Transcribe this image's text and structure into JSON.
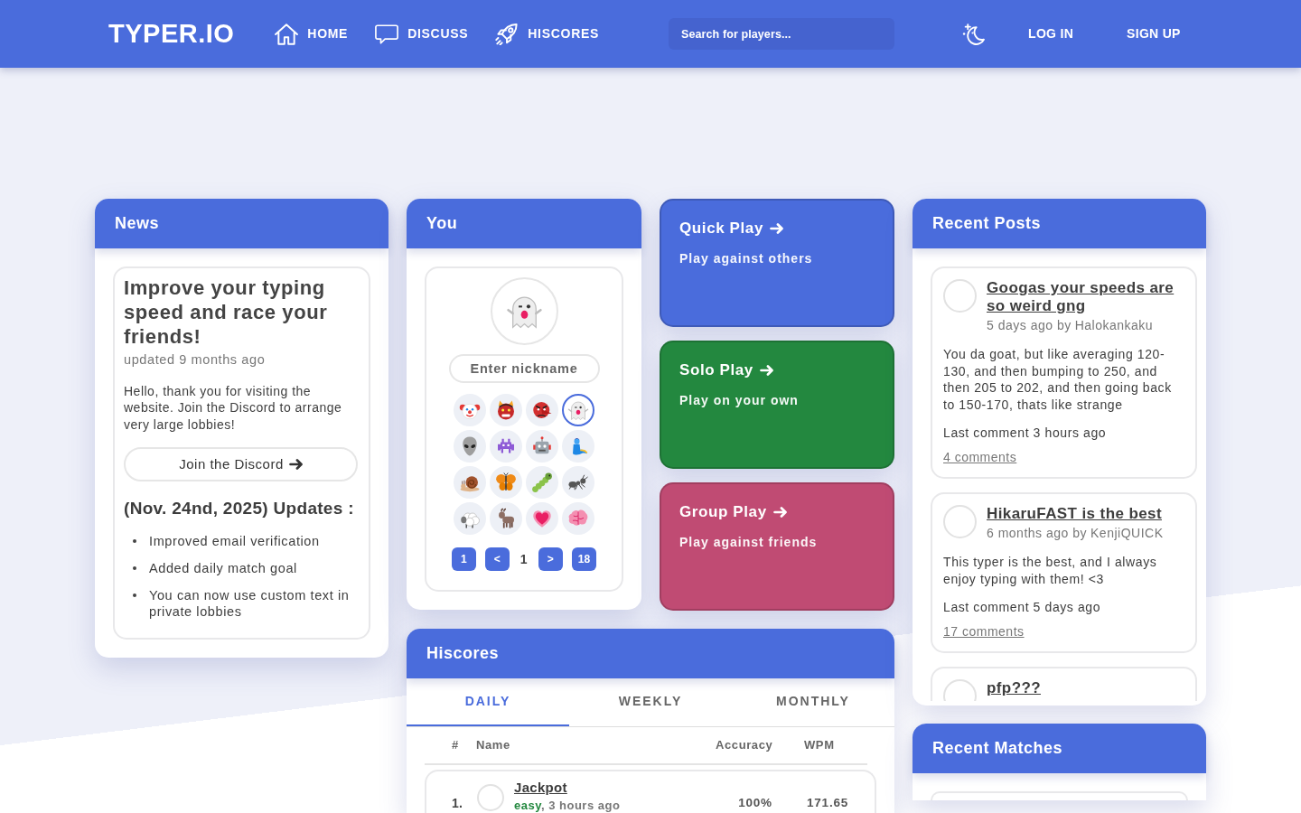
{
  "navbar": {
    "logo": "TYPER.IO",
    "links": [
      {
        "kind": "home",
        "label": "HOME"
      },
      {
        "kind": "discuss",
        "label": "DISCUSS"
      },
      {
        "kind": "hiscores",
        "label": "HISCORES"
      }
    ],
    "search": {
      "placeholder": "Search for players..."
    },
    "log_in": "LOG IN",
    "sign_up": "SIGN UP"
  },
  "news": {
    "title": "News",
    "headline": "Improve your typing speed and race your friends!",
    "updated": "updated 9 months ago",
    "body": "Hello, thank you for visiting the website. Join the Discord to arrange very large lobbies!",
    "button": "Join the Discord",
    "updates_title": "(Nov. 24nd, 2025) Updates :",
    "updates": [
      "Improved email verification",
      "Added daily match goal",
      "You can now use custom text in private lobbies"
    ]
  },
  "you": {
    "title": "You",
    "nickname": {
      "placeholder": "Enter nickname"
    },
    "avatars": [
      {
        "kind": "clown",
        "selected": false
      },
      {
        "kind": "ogre",
        "selected": false
      },
      {
        "kind": "goblin",
        "selected": false
      },
      {
        "kind": "ghost",
        "selected": true
      },
      {
        "kind": "alien",
        "selected": false
      },
      {
        "kind": "invader",
        "selected": false
      },
      {
        "kind": "robot",
        "selected": false
      },
      {
        "kind": "genie",
        "selected": false
      },
      {
        "kind": "snail",
        "selected": false
      },
      {
        "kind": "butterfly",
        "selected": false
      },
      {
        "kind": "caterpillar",
        "selected": false
      },
      {
        "kind": "ant",
        "selected": false
      },
      {
        "kind": "sheep",
        "selected": false
      },
      {
        "kind": "goat",
        "selected": false
      },
      {
        "kind": "heart",
        "selected": false
      },
      {
        "kind": "brain",
        "selected": false
      }
    ],
    "pagination": {
      "first": "1",
      "previous": "<",
      "current": "1",
      "next": ">",
      "last": "18"
    }
  },
  "play_modes": [
    {
      "title": "Quick Play",
      "subtitle": "Play against others",
      "color": "#4a6cdc"
    },
    {
      "title": "Solo Play",
      "subtitle": "Play on your own",
      "color": "#23883f"
    },
    {
      "title": "Group Play",
      "subtitle": "Play against friends",
      "color": "#c04b73"
    }
  ],
  "recent_posts": {
    "title": "Recent Posts",
    "posts": [
      {
        "title": "Googas your speeds are so weird gng",
        "time": "5 days ago by",
        "author": "Halokankaku",
        "body": "You da goat, but like averaging 120-130, and then bumping to 250, and then 205 to 202, and then going back to 150-170, thats like strange",
        "last_comment": "Last comment 3 hours ago",
        "comments": "4 comments"
      },
      {
        "title": "HikaruFAST is the best",
        "time": "6 months ago by",
        "author": "KenjiQUICK",
        "body": "This typer is the best, and I always enjoy typing with them! <3",
        "last_comment": "Last comment 5 days ago",
        "comments": "17 comments"
      },
      {
        "title": "pfp???"
      }
    ]
  },
  "hiscores": {
    "title": "Hiscores",
    "tabs": [
      {
        "label": "DAILY",
        "selected": true
      },
      {
        "label": "WEEKLY",
        "selected": false
      },
      {
        "label": "MONTHLY",
        "selected": false
      }
    ],
    "columns": [
      "#",
      "Name",
      "Accuracy",
      "WPM"
    ],
    "rows": [
      {
        "rank": "1.",
        "name": "Jackpot",
        "difficulty": "easy",
        "time": ", 3 hours ago",
        "accuracy": "100%",
        "wpm": "171.65"
      }
    ]
  },
  "recent_matches": {
    "title": "Recent Matches"
  }
}
